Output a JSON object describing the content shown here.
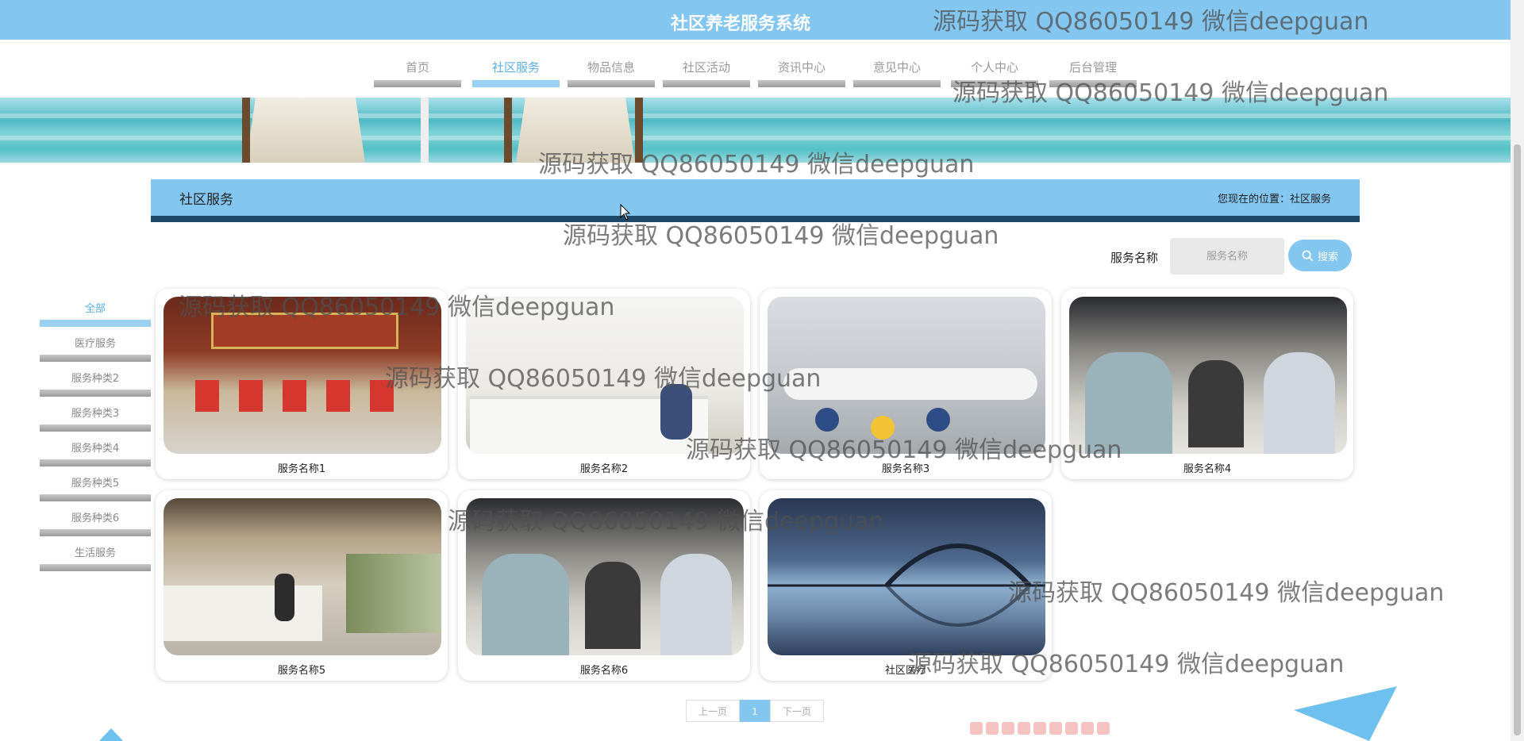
{
  "header": {
    "site_title": "社区养老服务系统"
  },
  "nav": {
    "items": [
      "首页",
      "社区服务",
      "物品信息",
      "社区活动",
      "资讯中心",
      "意见中心",
      "个人中心",
      "后台管理"
    ],
    "active_index": 1
  },
  "section": {
    "title": "社区服务",
    "breadcrumb": "您现在的位置：社区服务"
  },
  "search": {
    "label": "服务名称",
    "placeholder": "服务名称",
    "button_label": "搜索"
  },
  "sidebar": {
    "items": [
      "全部",
      "医疗服务",
      "服务种类2",
      "服务种类3",
      "服务种类4",
      "服务种类5",
      "服务种类6",
      "生活服务"
    ],
    "active_index": 0
  },
  "cards": [
    {
      "name": "服务名称1"
    },
    {
      "name": "服务名称2"
    },
    {
      "name": "服务名称3"
    },
    {
      "name": "服务名称4"
    },
    {
      "name": "服务名称5"
    },
    {
      "name": "服务名称6"
    },
    {
      "name": "社区医疗"
    }
  ],
  "pagination": {
    "prev_label": "上一页",
    "current_page": "1",
    "next_label": "下一页"
  },
  "watermark_text": "源码获取 QQ86050149 微信deepguan",
  "colors": {
    "primary": "#83c6f0",
    "dark_accent": "#1c4a68",
    "active_text": "#5cb0e6"
  }
}
